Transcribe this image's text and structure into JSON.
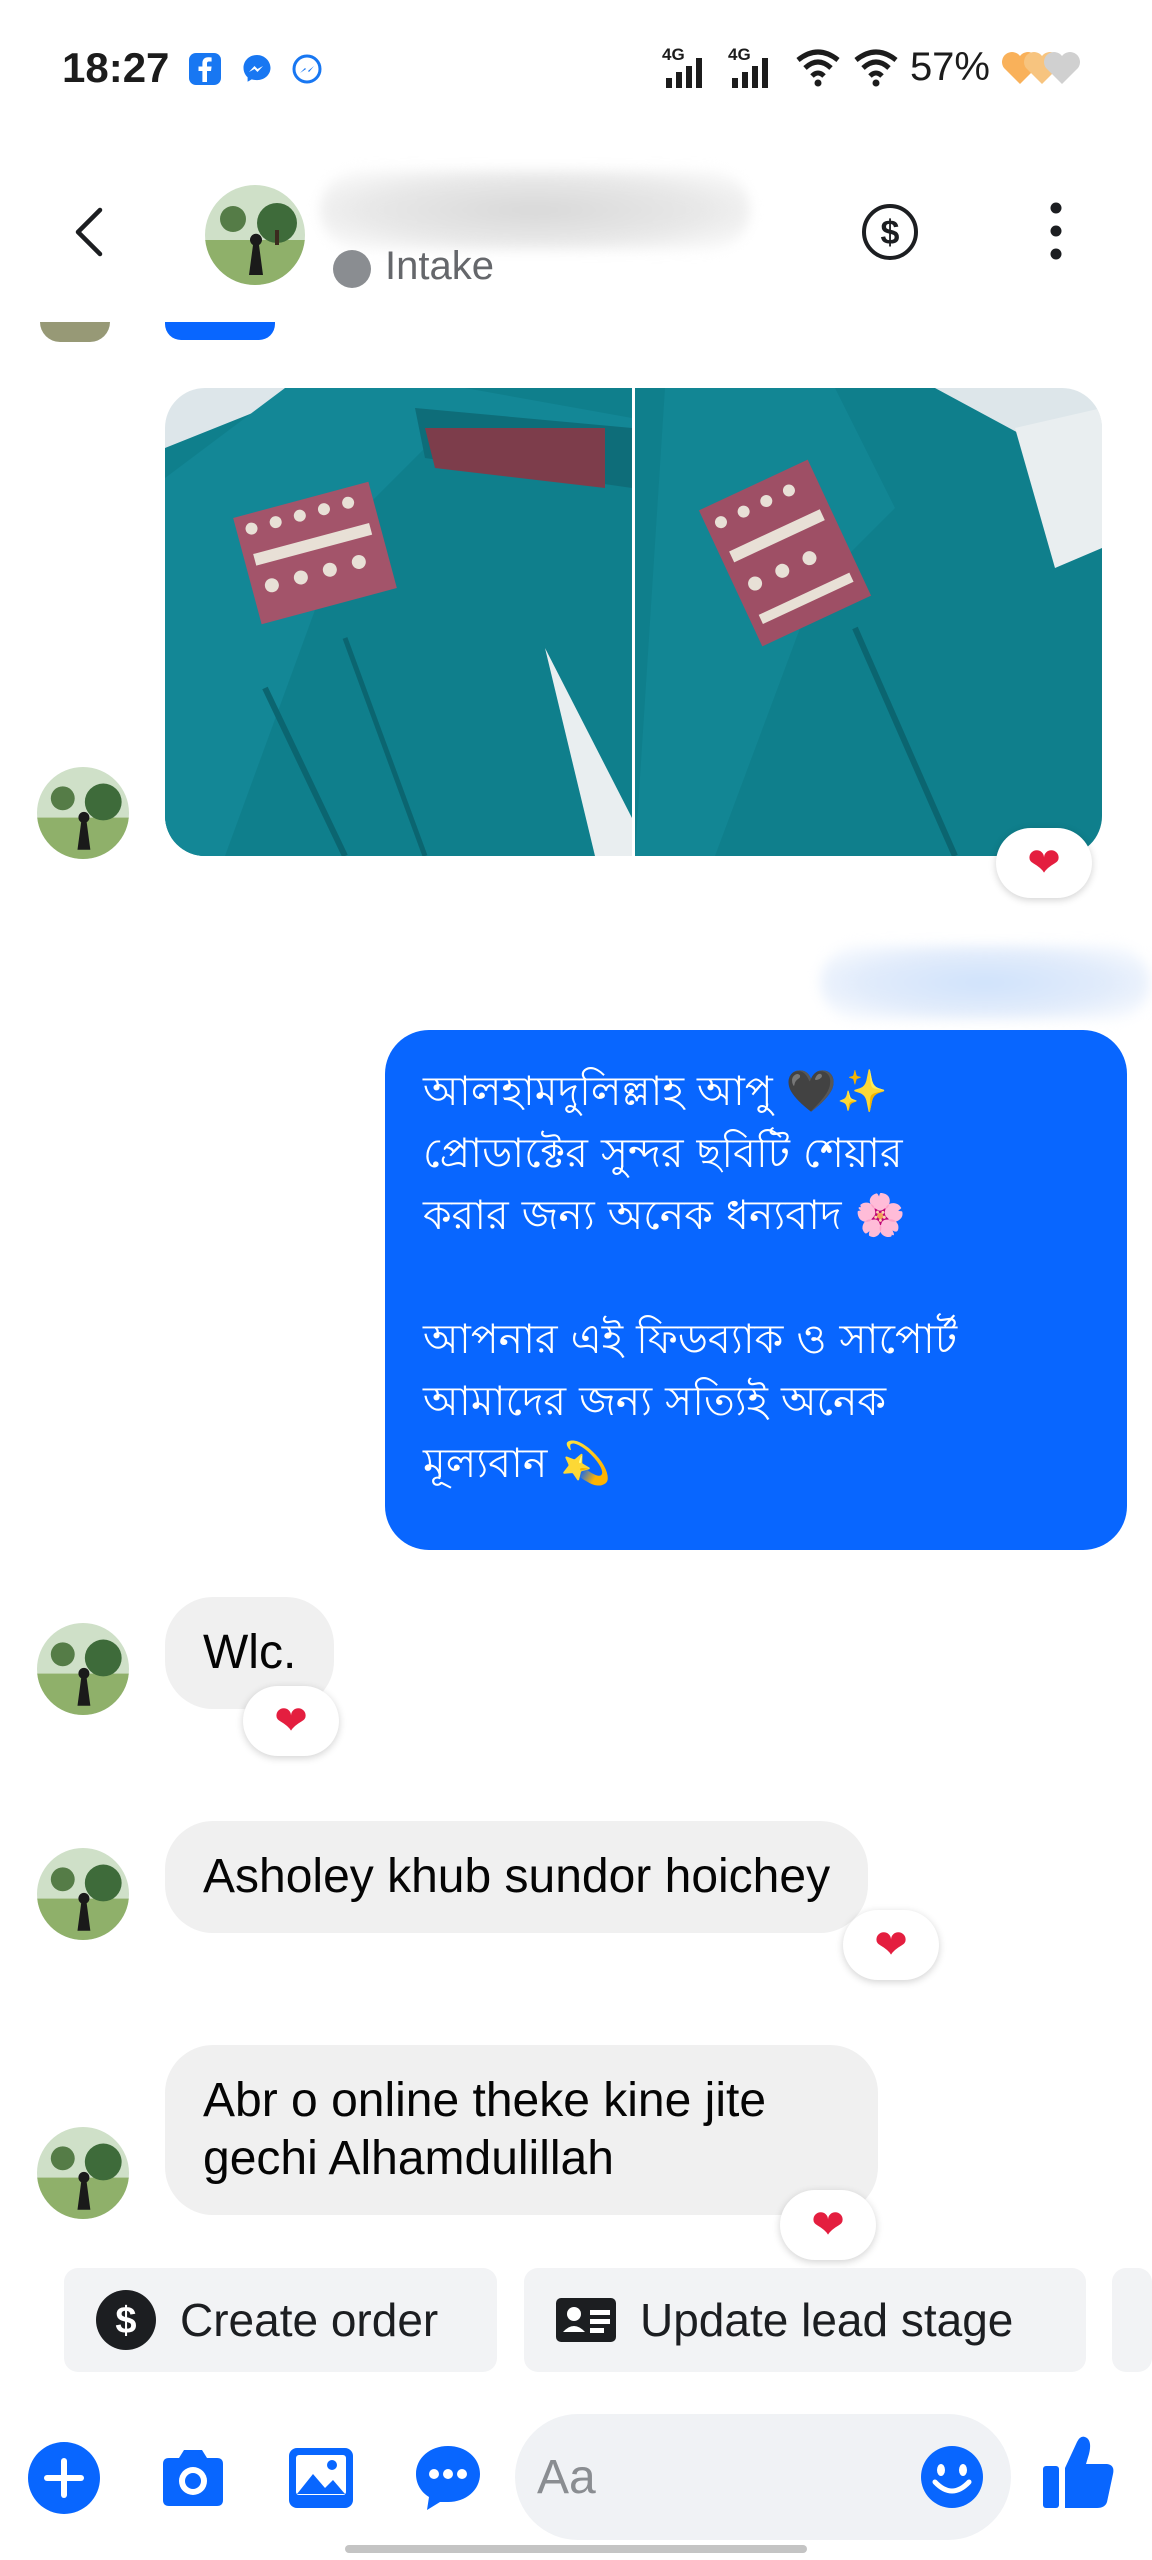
{
  "status_bar": {
    "time": "18:27",
    "battery": "57%",
    "network_1": "4G",
    "network_2": "4G",
    "icons": [
      "facebook-icon",
      "messenger-icon",
      "messenger-kids-icon",
      "signal-icon",
      "wifi-icon",
      "heart-battery-icon"
    ]
  },
  "header": {
    "status": "Intake",
    "icons": [
      "back-icon",
      "dollar-icon",
      "more-icon"
    ]
  },
  "messages": {
    "outgoing": {
      "line1": "আলহামদুলিল্লাহ আপু 🖤✨",
      "line2": "প্রোডাক্টের সুন্দর ছবিটি শেয়ার",
      "line3": "করার জন্য অনেক ধন্যবাদ 🌸",
      "line4": "আপনার এই ফিডব্যাক ও সাপোর্ট",
      "line5": "আমাদের জন্য সত্যিই অনেক",
      "line6": "মূল্যবান 💫"
    },
    "incoming_1": "Wlc.",
    "incoming_2": "Asholey khub sundor hoichey",
    "incoming_3_line1": "Abr o online theke kine jite",
    "incoming_3_line2": "gechi Alhamdulillah",
    "reaction": "❤"
  },
  "quick_actions": {
    "create_order": "Create order",
    "update_lead_stage": "Update lead stage"
  },
  "composer": {
    "placeholder": "Aa"
  },
  "colors": {
    "accent": "#0866ff",
    "incoming_bubble": "#f0f0f0",
    "heart": "#e41e3f"
  }
}
